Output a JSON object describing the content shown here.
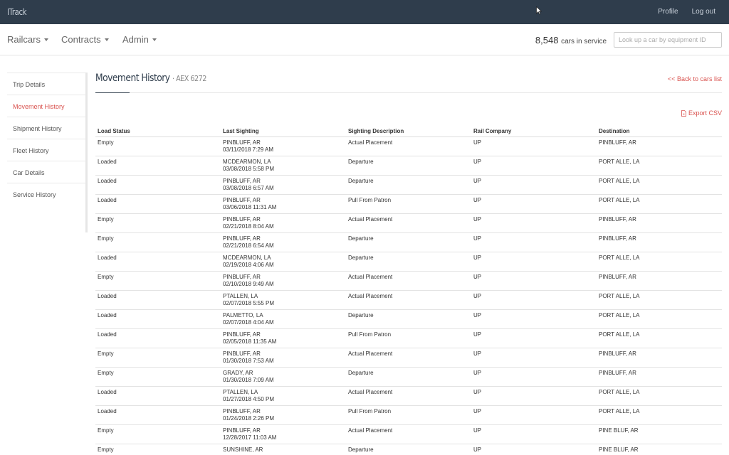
{
  "app": {
    "brand": "ITrack"
  },
  "topnav": {
    "profile": "Profile",
    "logout": "Log out"
  },
  "subnav": {
    "menus": [
      "Railcars",
      "Contracts",
      "Admin"
    ],
    "count": "8,548",
    "count_label": "cars in service",
    "lookup_placeholder": "Look up a car by equipment ID"
  },
  "sidebar": {
    "items": [
      {
        "label": "Trip Details",
        "active": false
      },
      {
        "label": "Movement History",
        "active": true
      },
      {
        "label": "Shipment History",
        "active": false
      },
      {
        "label": "Fleet History",
        "active": false
      },
      {
        "label": "Car Details",
        "active": false
      },
      {
        "label": "Service History",
        "active": false
      }
    ]
  },
  "main": {
    "title": "Movement History",
    "car_id": "· AEX 6272",
    "back_link": "<< Back to cars list",
    "export": "Export CSV",
    "columns": [
      "Load Status",
      "Last Sighting",
      "Sighting Description",
      "Rail Company",
      "Destination"
    ],
    "rows": [
      {
        "status": "Empty",
        "location": "PINBLUFF, AR",
        "datetime": "03/11/2018 7:29 AM",
        "desc": "Actual Placement",
        "rail": "UP",
        "dest": "PINBLUFF, AR"
      },
      {
        "status": "Loaded",
        "location": "MCDEARMON, LA",
        "datetime": "03/08/2018 5:58 PM",
        "desc": "Departure",
        "rail": "UP",
        "dest": "PORT ALLE, LA"
      },
      {
        "status": "Loaded",
        "location": "PINBLUFF, AR",
        "datetime": "03/08/2018 6:57 AM",
        "desc": "Departure",
        "rail": "UP",
        "dest": "PORT ALLE, LA"
      },
      {
        "status": "Loaded",
        "location": "PINBLUFF, AR",
        "datetime": "03/06/2018 11:31 AM",
        "desc": "Pull From Patron",
        "rail": "UP",
        "dest": "PORT ALLE, LA"
      },
      {
        "status": "Empty",
        "location": "PINBLUFF, AR",
        "datetime": "02/21/2018 8:04 AM",
        "desc": "Actual Placement",
        "rail": "UP",
        "dest": "PINBLUFF, AR"
      },
      {
        "status": "Empty",
        "location": "PINBLUFF, AR",
        "datetime": "02/21/2018 6:54 AM",
        "desc": "Departure",
        "rail": "UP",
        "dest": "PINBLUFF, AR"
      },
      {
        "status": "Loaded",
        "location": "MCDEARMON, LA",
        "datetime": "02/19/2018 4:06 AM",
        "desc": "Departure",
        "rail": "UP",
        "dest": "PORT ALLE, LA"
      },
      {
        "status": "Empty",
        "location": "PINBLUFF, AR",
        "datetime": "02/10/2018 9:49 AM",
        "desc": "Actual Placement",
        "rail": "UP",
        "dest": "PINBLUFF, AR"
      },
      {
        "status": "Loaded",
        "location": "PTALLEN, LA",
        "datetime": "02/07/2018 5:55 PM",
        "desc": "Actual Placement",
        "rail": "UP",
        "dest": "PORT ALLE, LA"
      },
      {
        "status": "Loaded",
        "location": "PALMETTO, LA",
        "datetime": "02/07/2018 4:04 AM",
        "desc": "Departure",
        "rail": "UP",
        "dest": "PORT ALLE, LA"
      },
      {
        "status": "Loaded",
        "location": "PINBLUFF, AR",
        "datetime": "02/05/2018 11:35 AM",
        "desc": "Pull From Patron",
        "rail": "UP",
        "dest": "PORT ALLE, LA"
      },
      {
        "status": "Empty",
        "location": "PINBLUFF, AR",
        "datetime": "01/30/2018 7:53 AM",
        "desc": "Actual Placement",
        "rail": "UP",
        "dest": "PINBLUFF, AR"
      },
      {
        "status": "Empty",
        "location": "GRADY, AR",
        "datetime": "01/30/2018 7:09 AM",
        "desc": "Departure",
        "rail": "UP",
        "dest": "PINBLUFF, AR"
      },
      {
        "status": "Loaded",
        "location": "PTALLEN, LA",
        "datetime": "01/27/2018 4:50 PM",
        "desc": "Actual Placement",
        "rail": "UP",
        "dest": "PORT ALLE, LA"
      },
      {
        "status": "Loaded",
        "location": "PINBLUFF, AR",
        "datetime": "01/24/2018 2:26 PM",
        "desc": "Pull From Patron",
        "rail": "UP",
        "dest": "PORT ALLE, LA"
      },
      {
        "status": "Empty",
        "location": "PINBLUFF, AR",
        "datetime": "12/28/2017 11:03 AM",
        "desc": "Actual Placement",
        "rail": "UP",
        "dest": "PINE BLUF, AR"
      },
      {
        "status": "Empty",
        "location": "SUNSHINE, AR",
        "datetime": "",
        "desc": "Departure",
        "rail": "UP",
        "dest": "PINE BLUF, AR"
      }
    ]
  }
}
